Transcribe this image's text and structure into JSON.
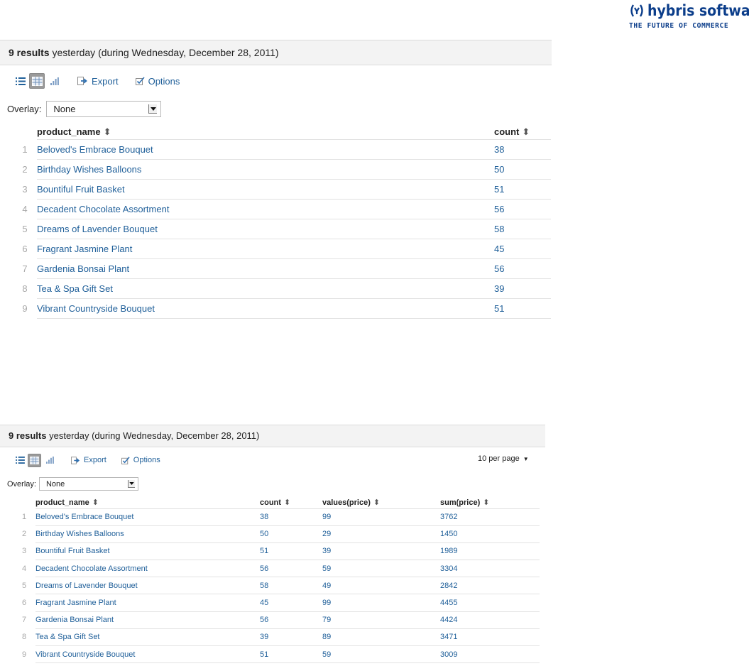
{
  "logo": {
    "brand": "hybris software",
    "tagline": "THE FUTURE OF COMMERCE",
    "color": "#0b3d8a"
  },
  "panel1": {
    "title_count": "9 results",
    "title_rest": " yesterday (during Wednesday, December 28, 2011)",
    "toolbar": {
      "list_icon": "list-icon",
      "table_icon": "table-icon",
      "chart_icon": "chart-icon",
      "export_label": "Export",
      "options_label": "Options"
    },
    "overlay": {
      "label": "Overlay:",
      "value": "None"
    },
    "columns": [
      "product_name",
      "count"
    ],
    "rows": [
      {
        "n": "1",
        "product_name": "Beloved's Embrace Bouquet",
        "count": "38"
      },
      {
        "n": "2",
        "product_name": "Birthday Wishes Balloons",
        "count": "50"
      },
      {
        "n": "3",
        "product_name": "Bountiful Fruit Basket",
        "count": "51"
      },
      {
        "n": "4",
        "product_name": "Decadent Chocolate Assortment",
        "count": "56"
      },
      {
        "n": "5",
        "product_name": "Dreams of Lavender Bouquet",
        "count": "58"
      },
      {
        "n": "6",
        "product_name": "Fragrant Jasmine Plant",
        "count": "45"
      },
      {
        "n": "7",
        "product_name": "Gardenia Bonsai Plant",
        "count": "56"
      },
      {
        "n": "8",
        "product_name": "Tea & Spa Gift Set",
        "count": "39"
      },
      {
        "n": "9",
        "product_name": "Vibrant Countryside Bouquet",
        "count": "51"
      }
    ]
  },
  "panel2": {
    "title_count": "9 results",
    "title_rest": " yesterday (during Wednesday, December 28, 2011)",
    "toolbar": {
      "list_icon": "list-icon",
      "table_icon": "table-icon",
      "chart_icon": "chart-icon",
      "export_label": "Export",
      "options_label": "Options",
      "per_page": "10 per page"
    },
    "overlay": {
      "label": "Overlay:",
      "value": "None"
    },
    "columns": [
      "product_name",
      "count",
      "values(price)",
      "sum(price)"
    ],
    "rows": [
      {
        "n": "1",
        "product_name": "Beloved's Embrace Bouquet",
        "count": "38",
        "values_price": "99",
        "sum_price": "3762"
      },
      {
        "n": "2",
        "product_name": "Birthday Wishes Balloons",
        "count": "50",
        "values_price": "29",
        "sum_price": "1450"
      },
      {
        "n": "3",
        "product_name": "Bountiful Fruit Basket",
        "count": "51",
        "values_price": "39",
        "sum_price": "1989"
      },
      {
        "n": "4",
        "product_name": "Decadent Chocolate Assortment",
        "count": "56",
        "values_price": "59",
        "sum_price": "3304"
      },
      {
        "n": "5",
        "product_name": "Dreams of Lavender Bouquet",
        "count": "58",
        "values_price": "49",
        "sum_price": "2842"
      },
      {
        "n": "6",
        "product_name": "Fragrant Jasmine Plant",
        "count": "45",
        "values_price": "99",
        "sum_price": "4455"
      },
      {
        "n": "7",
        "product_name": "Gardenia Bonsai Plant",
        "count": "56",
        "values_price": "79",
        "sum_price": "4424"
      },
      {
        "n": "8",
        "product_name": "Tea & Spa Gift Set",
        "count": "39",
        "values_price": "89",
        "sum_price": "3471"
      },
      {
        "n": "9",
        "product_name": "Vibrant Countryside Bouquet",
        "count": "51",
        "values_price": "59",
        "sum_price": "3009"
      }
    ]
  },
  "colors": {
    "link": "#1f5f99",
    "header_band": "#f3f3f3",
    "row_number": "#a8a8a8"
  }
}
